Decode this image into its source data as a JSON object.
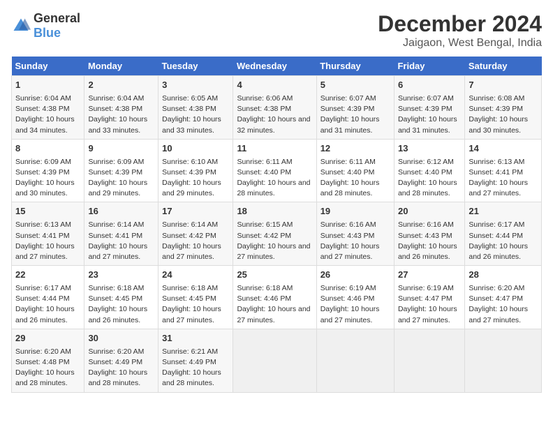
{
  "header": {
    "logo_general": "General",
    "logo_blue": "Blue",
    "title": "December 2024",
    "subtitle": "Jaigaon, West Bengal, India"
  },
  "calendar": {
    "days_of_week": [
      "Sunday",
      "Monday",
      "Tuesday",
      "Wednesday",
      "Thursday",
      "Friday",
      "Saturday"
    ],
    "weeks": [
      [
        {
          "day": "1",
          "sunrise": "Sunrise: 6:04 AM",
          "sunset": "Sunset: 4:38 PM",
          "daylight": "Daylight: 10 hours and 34 minutes."
        },
        {
          "day": "2",
          "sunrise": "Sunrise: 6:04 AM",
          "sunset": "Sunset: 4:38 PM",
          "daylight": "Daylight: 10 hours and 33 minutes."
        },
        {
          "day": "3",
          "sunrise": "Sunrise: 6:05 AM",
          "sunset": "Sunset: 4:38 PM",
          "daylight": "Daylight: 10 hours and 33 minutes."
        },
        {
          "day": "4",
          "sunrise": "Sunrise: 6:06 AM",
          "sunset": "Sunset: 4:38 PM",
          "daylight": "Daylight: 10 hours and 32 minutes."
        },
        {
          "day": "5",
          "sunrise": "Sunrise: 6:07 AM",
          "sunset": "Sunset: 4:39 PM",
          "daylight": "Daylight: 10 hours and 31 minutes."
        },
        {
          "day": "6",
          "sunrise": "Sunrise: 6:07 AM",
          "sunset": "Sunset: 4:39 PM",
          "daylight": "Daylight: 10 hours and 31 minutes."
        },
        {
          "day": "7",
          "sunrise": "Sunrise: 6:08 AM",
          "sunset": "Sunset: 4:39 PM",
          "daylight": "Daylight: 10 hours and 30 minutes."
        }
      ],
      [
        {
          "day": "8",
          "sunrise": "Sunrise: 6:09 AM",
          "sunset": "Sunset: 4:39 PM",
          "daylight": "Daylight: 10 hours and 30 minutes."
        },
        {
          "day": "9",
          "sunrise": "Sunrise: 6:09 AM",
          "sunset": "Sunset: 4:39 PM",
          "daylight": "Daylight: 10 hours and 29 minutes."
        },
        {
          "day": "10",
          "sunrise": "Sunrise: 6:10 AM",
          "sunset": "Sunset: 4:39 PM",
          "daylight": "Daylight: 10 hours and 29 minutes."
        },
        {
          "day": "11",
          "sunrise": "Sunrise: 6:11 AM",
          "sunset": "Sunset: 4:40 PM",
          "daylight": "Daylight: 10 hours and 28 minutes."
        },
        {
          "day": "12",
          "sunrise": "Sunrise: 6:11 AM",
          "sunset": "Sunset: 4:40 PM",
          "daylight": "Daylight: 10 hours and 28 minutes."
        },
        {
          "day": "13",
          "sunrise": "Sunrise: 6:12 AM",
          "sunset": "Sunset: 4:40 PM",
          "daylight": "Daylight: 10 hours and 28 minutes."
        },
        {
          "day": "14",
          "sunrise": "Sunrise: 6:13 AM",
          "sunset": "Sunset: 4:41 PM",
          "daylight": "Daylight: 10 hours and 27 minutes."
        }
      ],
      [
        {
          "day": "15",
          "sunrise": "Sunrise: 6:13 AM",
          "sunset": "Sunset: 4:41 PM",
          "daylight": "Daylight: 10 hours and 27 minutes."
        },
        {
          "day": "16",
          "sunrise": "Sunrise: 6:14 AM",
          "sunset": "Sunset: 4:41 PM",
          "daylight": "Daylight: 10 hours and 27 minutes."
        },
        {
          "day": "17",
          "sunrise": "Sunrise: 6:14 AM",
          "sunset": "Sunset: 4:42 PM",
          "daylight": "Daylight: 10 hours and 27 minutes."
        },
        {
          "day": "18",
          "sunrise": "Sunrise: 6:15 AM",
          "sunset": "Sunset: 4:42 PM",
          "daylight": "Daylight: 10 hours and 27 minutes."
        },
        {
          "day": "19",
          "sunrise": "Sunrise: 6:16 AM",
          "sunset": "Sunset: 4:43 PM",
          "daylight": "Daylight: 10 hours and 27 minutes."
        },
        {
          "day": "20",
          "sunrise": "Sunrise: 6:16 AM",
          "sunset": "Sunset: 4:43 PM",
          "daylight": "Daylight: 10 hours and 26 minutes."
        },
        {
          "day": "21",
          "sunrise": "Sunrise: 6:17 AM",
          "sunset": "Sunset: 4:44 PM",
          "daylight": "Daylight: 10 hours and 26 minutes."
        }
      ],
      [
        {
          "day": "22",
          "sunrise": "Sunrise: 6:17 AM",
          "sunset": "Sunset: 4:44 PM",
          "daylight": "Daylight: 10 hours and 26 minutes."
        },
        {
          "day": "23",
          "sunrise": "Sunrise: 6:18 AM",
          "sunset": "Sunset: 4:45 PM",
          "daylight": "Daylight: 10 hours and 26 minutes."
        },
        {
          "day": "24",
          "sunrise": "Sunrise: 6:18 AM",
          "sunset": "Sunset: 4:45 PM",
          "daylight": "Daylight: 10 hours and 27 minutes."
        },
        {
          "day": "25",
          "sunrise": "Sunrise: 6:18 AM",
          "sunset": "Sunset: 4:46 PM",
          "daylight": "Daylight: 10 hours and 27 minutes."
        },
        {
          "day": "26",
          "sunrise": "Sunrise: 6:19 AM",
          "sunset": "Sunset: 4:46 PM",
          "daylight": "Daylight: 10 hours and 27 minutes."
        },
        {
          "day": "27",
          "sunrise": "Sunrise: 6:19 AM",
          "sunset": "Sunset: 4:47 PM",
          "daylight": "Daylight: 10 hours and 27 minutes."
        },
        {
          "day": "28",
          "sunrise": "Sunrise: 6:20 AM",
          "sunset": "Sunset: 4:47 PM",
          "daylight": "Daylight: 10 hours and 27 minutes."
        }
      ],
      [
        {
          "day": "29",
          "sunrise": "Sunrise: 6:20 AM",
          "sunset": "Sunset: 4:48 PM",
          "daylight": "Daylight: 10 hours and 28 minutes."
        },
        {
          "day": "30",
          "sunrise": "Sunrise: 6:20 AM",
          "sunset": "Sunset: 4:49 PM",
          "daylight": "Daylight: 10 hours and 28 minutes."
        },
        {
          "day": "31",
          "sunrise": "Sunrise: 6:21 AM",
          "sunset": "Sunset: 4:49 PM",
          "daylight": "Daylight: 10 hours and 28 minutes."
        },
        null,
        null,
        null,
        null
      ]
    ]
  }
}
